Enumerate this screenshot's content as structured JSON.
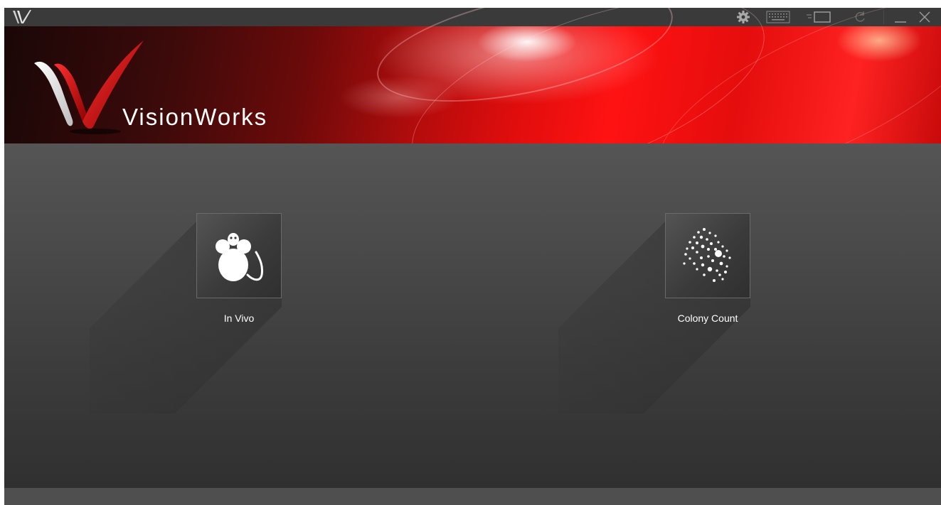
{
  "app": {
    "name": "VisionWorks"
  },
  "titlebar": {
    "icons": [
      "settings-gear-icon",
      "keyboard-icon",
      "camera-connect-icon",
      "refresh-icon",
      "minimize-icon",
      "close-icon"
    ]
  },
  "modules": [
    {
      "label": "In Vivo",
      "icon": "mouse-icon"
    },
    {
      "label": "Colony Count",
      "icon": "colony-dots-icon"
    }
  ],
  "colors": {
    "accent": "#e00d0d",
    "background": "#2e2e2e",
    "titlebar": "#3a3a3a"
  }
}
